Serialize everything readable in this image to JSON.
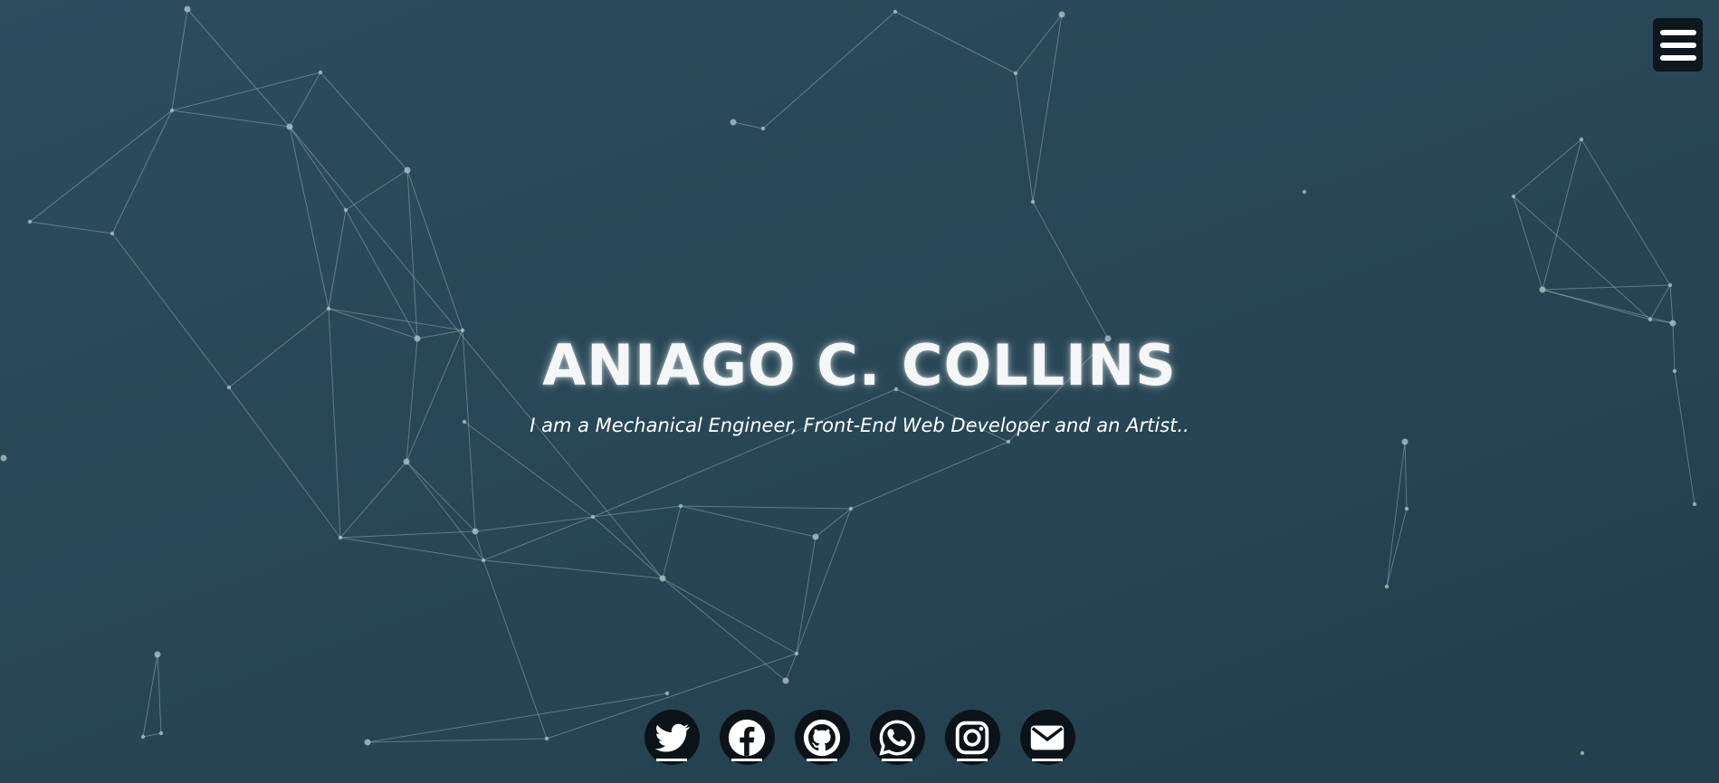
{
  "hero": {
    "name": "ANIAGO C. COLLINS",
    "tagline": "I am a Mechanical Engineer, Front-End Web Developer and an Artist.."
  },
  "menu": {
    "icon": "hamburger-menu-icon"
  },
  "socials": [
    {
      "name": "twitter",
      "icon": "twitter-icon"
    },
    {
      "name": "facebook",
      "icon": "facebook-icon"
    },
    {
      "name": "github",
      "icon": "github-icon"
    },
    {
      "name": "whatsapp",
      "icon": "whatsapp-icon"
    },
    {
      "name": "instagram",
      "icon": "instagram-icon"
    },
    {
      "name": "email",
      "icon": "envelope-icon"
    }
  ],
  "colors": {
    "background_top": "#2b4d5e",
    "background_bottom": "#233e4d",
    "icon_circle": "#0c1318",
    "menu_button": "#0e171d",
    "text": "#ffffff"
  }
}
